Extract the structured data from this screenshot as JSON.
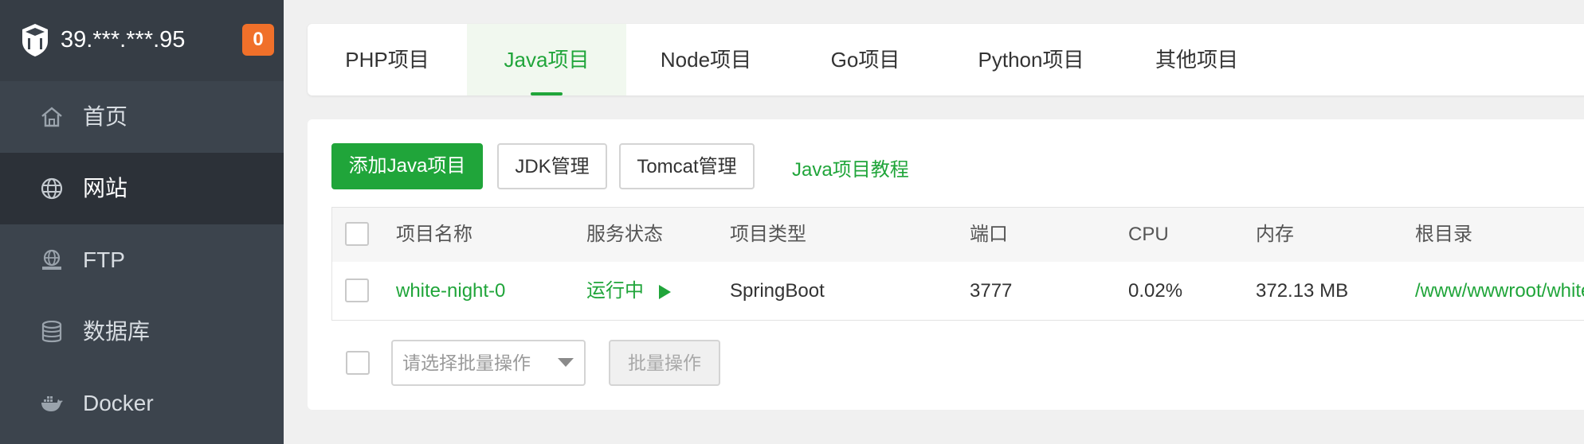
{
  "server": {
    "ip": "39.***.***.95",
    "alert_count": "0"
  },
  "sidebar": {
    "items": [
      {
        "label": "首页",
        "icon": "home-icon"
      },
      {
        "label": "网站",
        "icon": "globe-icon",
        "active": true
      },
      {
        "label": "FTP",
        "icon": "ftp-icon"
      },
      {
        "label": "数据库",
        "icon": "database-icon"
      },
      {
        "label": "Docker",
        "icon": "docker-icon"
      }
    ]
  },
  "tabs": [
    {
      "label": "PHP项目"
    },
    {
      "label": "Java项目",
      "active": true
    },
    {
      "label": "Node项目"
    },
    {
      "label": "Go项目"
    },
    {
      "label": "Python项目"
    },
    {
      "label": "其他项目"
    }
  ],
  "toolbar": {
    "add_label": "添加Java项目",
    "jdk_label": "JDK管理",
    "tomcat_label": "Tomcat管理",
    "tutorial_label": "Java项目教程"
  },
  "table": {
    "headers": [
      "项目名称",
      "服务状态",
      "项目类型",
      "端口",
      "CPU",
      "内存",
      "根目录"
    ],
    "rows": [
      {
        "name": "white-night-0",
        "status": "运行中",
        "type": "SpringBoot",
        "port": "3777",
        "cpu": "0.02%",
        "memory": "372.13 MB",
        "root": "/www/wwwroot/white"
      }
    ]
  },
  "batch": {
    "select_placeholder": "请选择批量操作",
    "button_label": "批量操作"
  },
  "colors": {
    "accent": "#20a53a",
    "sidebar_bg": "#3c444d",
    "badge": "#f0702a"
  }
}
